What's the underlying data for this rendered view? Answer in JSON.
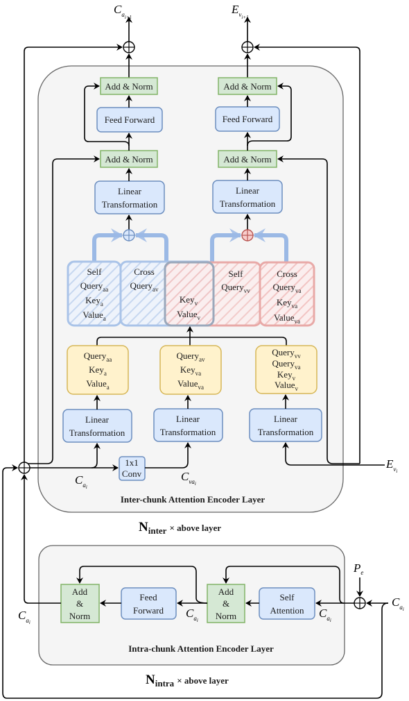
{
  "colors": {
    "add_norm_fill": "#d5e8d4",
    "add_norm_stroke": "#82b366",
    "block_fill": "#dae8fc",
    "block_stroke": "#6c8ebf",
    "qkv_fill": "#fff2cc",
    "qkv_stroke": "#d6b656",
    "audio_attention": "#7ea6e0",
    "video_attention": "#ea6b66",
    "panel_fill": "#f5f5f5"
  },
  "outputs": {
    "audio": {
      "base": "C",
      "sub": "a",
      "subsub": "i+1"
    },
    "video": {
      "base": "E",
      "sub": "v",
      "subsub": "i+1"
    }
  },
  "inter_layer": {
    "title": "Inter-chunk Attention Encoder Layer",
    "repeat": {
      "N": "N",
      "sub": "inter",
      "suffix": "× above layer"
    },
    "audio_branch": {
      "add_norm_top": "Add & Norm",
      "feed_forward": "Feed Forward",
      "add_norm_mid": "Add & Norm",
      "linear": [
        "Linear",
        "Transformation"
      ]
    },
    "video_branch": {
      "add_norm_top": "Add & Norm",
      "feed_forward": "Feed Forward",
      "add_norm_mid": "Add & Norm",
      "linear": [
        "Linear",
        "Transformation"
      ]
    },
    "attention": {
      "audio_self": {
        "title": "Self",
        "lines": [
          [
            "Query",
            "aa"
          ],
          [
            "Key",
            "a"
          ],
          [
            "Value",
            "a"
          ]
        ]
      },
      "audio_cross": {
        "title": "Cross",
        "lines": [
          [
            "Query",
            "av"
          ]
        ]
      },
      "shared_kv": {
        "lines": [
          [
            "Key",
            "v"
          ],
          [
            "Value",
            "v"
          ]
        ]
      },
      "video_self": {
        "title": "Self",
        "lines": [
          [
            "Query",
            "vv"
          ]
        ]
      },
      "video_cross": {
        "title": "Cross",
        "lines": [
          [
            "Query",
            "va"
          ],
          [
            "Key",
            "va"
          ],
          [
            "Value",
            "va"
          ]
        ]
      }
    },
    "qkv": {
      "audio": [
        [
          "Query",
          "aa"
        ],
        [
          "Key",
          "a"
        ],
        [
          "Value",
          "a"
        ]
      ],
      "cross": [
        [
          "Query",
          "av"
        ],
        [
          "Key",
          "va"
        ],
        [
          "Value",
          "va"
        ]
      ],
      "video": [
        [
          "Query",
          "vv"
        ],
        [
          "Query",
          "va"
        ],
        [
          "Key",
          "v"
        ],
        [
          "Value",
          "v"
        ]
      ]
    },
    "linear_inputs": [
      "Linear",
      "Transformation"
    ],
    "conv": [
      "1x1",
      "Conv"
    ],
    "labels": {
      "audio_in": {
        "base": "C",
        "sub": "a",
        "subsub": "i"
      },
      "cross_in": {
        "base": "C",
        "sub": "va",
        "subsub": "i"
      },
      "video_in": {
        "base": "E",
        "sub": "v",
        "subsub": "i"
      }
    }
  },
  "intra_layer": {
    "title": "Intra-chunk Attention Encoder Layer",
    "repeat": {
      "N": "N",
      "sub": "intra",
      "suffix": "× above layer"
    },
    "add_norm_left": [
      "Add",
      "&",
      "Norm"
    ],
    "feed_forward": [
      "Feed",
      "Forward"
    ],
    "add_norm_right": [
      "Add",
      "&",
      "Norm"
    ],
    "self_attention": [
      "Self",
      "Attention"
    ],
    "pos_enc": {
      "base": "P",
      "sub": "e"
    },
    "labels": {
      "input": {
        "base": "C",
        "sub": "a",
        "subsub": "i"
      },
      "after_pe": {
        "base": "C",
        "sub": "a",
        "subsub": "i"
      },
      "mid": {
        "base": "C",
        "sub": "a",
        "subsub": "i"
      },
      "output": {
        "base": "C",
        "sub": "a",
        "subsub": "i"
      }
    }
  }
}
